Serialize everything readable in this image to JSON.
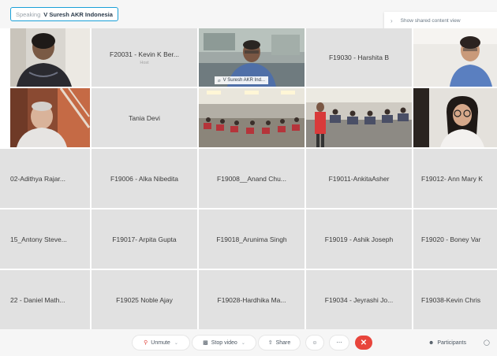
{
  "speaking": {
    "label": "Speaking",
    "name": "V Suresh AKR Indonesia"
  },
  "shared_content": {
    "label": "Show shared content view"
  },
  "tiles": {
    "r1c2": {
      "name": "F20031 - Kevin K Ber...",
      "sub": "Host"
    },
    "r1c3": {
      "label": "V Suresh AKR Ind..."
    },
    "r1c4": {
      "name": "F19030 - Harshita B"
    },
    "r2c2": {
      "name": "Tania Devi"
    },
    "r3c1": {
      "name": "02-Adithya Rajar..."
    },
    "r3c2": {
      "name": "F19006 - Alka Nibedita"
    },
    "r3c3": {
      "name": "F19008__Anand Chu..."
    },
    "r3c4": {
      "name": "F19011-AnkitaAsher"
    },
    "r3c5": {
      "name": "F19012- Ann Mary K"
    },
    "r4c1": {
      "name": "15_Antony Steve..."
    },
    "r4c2": {
      "name": "F19017- Arpita Gupta"
    },
    "r4c3": {
      "name": "F19018_Arunima Singh"
    },
    "r4c4": {
      "name": "F19019 - Ashik Joseph"
    },
    "r4c5": {
      "name": "F19020 - Boney Var"
    },
    "r5c1": {
      "name": "22 - Daniel Math..."
    },
    "r5c2": {
      "name": "F19025 Noble Ajay"
    },
    "r5c3": {
      "name": "F19028-Hardhika Ma..."
    },
    "r5c4": {
      "name": "F19034 - Jeyrashi Jo..."
    },
    "r5c5": {
      "name": "F19038-Kevin Chris"
    }
  },
  "controls": {
    "unmute": "Unmute",
    "stop_video": "Stop video",
    "share": "Share",
    "participants": "Participants"
  },
  "icons": {
    "mic": "microphone-muted-icon",
    "video": "video-camera-icon",
    "share": "share-screen-icon",
    "reactions": "reactions-icon",
    "more": "more-options-icon",
    "leave": "leave-meeting-icon",
    "participants": "participants-icon",
    "chat": "chat-icon"
  },
  "colors": {
    "accent": "#1aa0d8",
    "leave": "#e8453c",
    "muted": "#e0413a"
  }
}
